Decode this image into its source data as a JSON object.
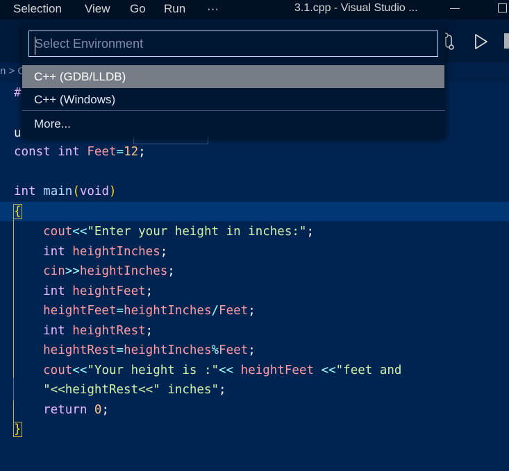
{
  "menu": {
    "selection": "Selection",
    "view": "View",
    "go": "Go",
    "run": "Run",
    "more": "···"
  },
  "window_title": "3.1.cpp - Visual Studio ...",
  "breadcrumb": "n > C",
  "quick_pick": {
    "placeholder": "Select Environment",
    "items": [
      {
        "label": "C++ (GDB/LLDB)"
      },
      {
        "label": "C++ (Windows)"
      },
      {
        "label": "More..."
      }
    ]
  },
  "code": {
    "hash": "#",
    "using_partial": "u",
    "l_const": {
      "kw": "const int ",
      "id": "Feet",
      "op": "=",
      "num": "12",
      "end": ";"
    },
    "l_main": {
      "kw": "int ",
      "fn": "main",
      "p1": "(",
      "kw2": "void",
      "p2": ")"
    },
    "open_brace": "{",
    "close_brace": "}",
    "body": [
      [
        {
          "c": "id",
          "t": "    cout"
        },
        {
          "c": "op",
          "t": "<<"
        },
        {
          "c": "str",
          "t": "\"Enter your height in inches:\""
        },
        {
          "c": "pl",
          "t": ";"
        }
      ],
      [
        {
          "c": "kw",
          "t": "    int "
        },
        {
          "c": "id",
          "t": "heightInches"
        },
        {
          "c": "pl",
          "t": ";"
        }
      ],
      [
        {
          "c": "id",
          "t": "    cin"
        },
        {
          "c": "op",
          "t": ">>"
        },
        {
          "c": "id",
          "t": "heightInches"
        },
        {
          "c": "pl",
          "t": ";"
        }
      ],
      [
        {
          "c": "kw",
          "t": "    int "
        },
        {
          "c": "id",
          "t": "heightFeet"
        },
        {
          "c": "pl",
          "t": ";"
        }
      ],
      [
        {
          "c": "id",
          "t": "    heightFeet"
        },
        {
          "c": "op",
          "t": "="
        },
        {
          "c": "id",
          "t": "heightInches"
        },
        {
          "c": "op",
          "t": "/"
        },
        {
          "c": "id",
          "t": "Feet"
        },
        {
          "c": "pl",
          "t": ";"
        }
      ],
      [
        {
          "c": "kw",
          "t": "    int "
        },
        {
          "c": "id",
          "t": "heightRest"
        },
        {
          "c": "pl",
          "t": ";"
        }
      ],
      [
        {
          "c": "id",
          "t": "    heightRest"
        },
        {
          "c": "op",
          "t": "="
        },
        {
          "c": "id",
          "t": "heightInches"
        },
        {
          "c": "op",
          "t": "%"
        },
        {
          "c": "id",
          "t": "Feet"
        },
        {
          "c": "pl",
          "t": ";"
        }
      ],
      [
        {
          "c": "id",
          "t": "    cout"
        },
        {
          "c": "op",
          "t": "<<"
        },
        {
          "c": "str",
          "t": "\"Your height is :\""
        },
        {
          "c": "op",
          "t": "<<"
        },
        {
          "c": "pl",
          "t": " "
        },
        {
          "c": "id",
          "t": "heightFeet"
        },
        {
          "c": "pl",
          "t": " "
        },
        {
          "c": "op",
          "t": "<<"
        },
        {
          "c": "str",
          "t": "\"feet and"
        }
      ],
      [
        {
          "c": "str",
          "t": "    \"<<heightRest<<\" inches\""
        },
        {
          "c": "pl",
          "t": ";"
        }
      ],
      [
        {
          "c": "kw",
          "t": "    return "
        },
        {
          "c": "num",
          "t": "0"
        },
        {
          "c": "pl",
          "t": ";"
        }
      ]
    ]
  },
  "icons": {
    "minimize": "minimize-icon",
    "maximize": "maximize-icon",
    "compare": "compare-icon",
    "run": "run-icon"
  }
}
